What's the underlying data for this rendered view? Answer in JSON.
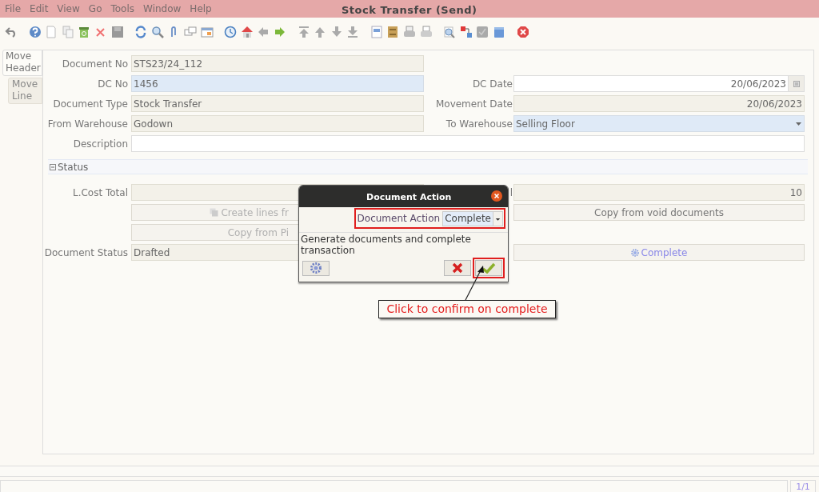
{
  "menu": [
    "File",
    "Edit",
    "View",
    "Go",
    "Tools",
    "Window",
    "Help"
  ],
  "window": {
    "title": "Stock Transfer (Send)"
  },
  "tabs": [
    {
      "label": "Move Header",
      "selected": true
    },
    {
      "label": "Move Line",
      "selected": false
    }
  ],
  "header_rows": [
    {
      "left": {
        "label": "Document No",
        "value": "STS23/24_112",
        "kind": "readonly"
      }
    },
    {
      "left": {
        "label": "DC No",
        "value": "1456",
        "kind": "mandatory"
      },
      "right": {
        "label": "DC Date",
        "value": "20/06/2023",
        "kind": "date"
      }
    },
    {
      "left": {
        "label": "Document Type",
        "value": "Stock Transfer",
        "kind": "readonly"
      },
      "right": {
        "label": "Movement Date",
        "value": "20/06/2023",
        "kind": "readonly-right"
      }
    },
    {
      "left": {
        "label": "From Warehouse",
        "value": "Godown",
        "kind": "readonly"
      },
      "right": {
        "label": "To Warehouse",
        "value": "Selling Floor",
        "kind": "select"
      }
    },
    {
      "full": {
        "label": "Description",
        "kind": "text"
      }
    }
  ],
  "status_section": {
    "title": "Status",
    "expanded": true
  },
  "status_rows": [
    {
      "left": {
        "label": "L.Cost Total",
        "kind": "readonly"
      },
      "right": {
        "label": "l",
        "value": "10",
        "kind": "readonly-right"
      }
    },
    {
      "left": {
        "kind": "button",
        "label": "Create lines fr",
        "disabled": true
      },
      "right": {
        "kind": "button",
        "label": "Copy from void documents",
        "disabled": false
      }
    },
    {
      "left": {
        "kind": "button",
        "label": "Copy from Pi",
        "disabled": true
      }
    },
    {
      "left": {
        "label": "Document Status",
        "value": "Drafted",
        "kind": "readonly"
      },
      "right": {
        "kind": "action-button",
        "label": "Complete",
        "disabled": false
      }
    }
  ],
  "dialog": {
    "title": "Document Action",
    "action_label": "Document Action",
    "action_value": "Complete",
    "description": "Generate documents and complete transaction"
  },
  "callout": {
    "text": "Click to confirm on complete"
  },
  "status_bar": {
    "page": "1/1"
  }
}
